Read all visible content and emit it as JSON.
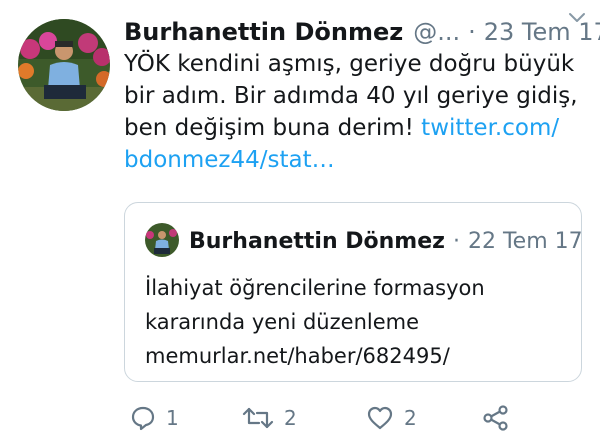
{
  "tweet": {
    "author_name": "Burhanettin Dönmez",
    "handle": "@...",
    "separator": "·",
    "time": "23 Tem 17",
    "text_lines": [
      "YÖK kendini aşmış, geriye doğru büyük",
      "bir adım. Bir adımda 40 yıl geriye gidiş,"
    ],
    "text_line3_prefix": "ben değişim buna derim! ",
    "link_part1": "twitter.com/",
    "link_part2": "bdonmez44/stat…"
  },
  "quoted_tweet": {
    "author_name": "Burhanettin Dönmez",
    "separator": "·",
    "time": "22 Tem 17",
    "text_lines": [
      "İlahiyat öğrencilerine formasyon",
      "kararında yeni düzenleme",
      "memurlar.net/haber/682495/"
    ]
  },
  "actions": {
    "reply_count": "1",
    "retweet_count": "2",
    "like_count": "2"
  },
  "colors": {
    "link": "#1da1f2",
    "muted": "#657786",
    "border": "#ccd6dd"
  },
  "icons": [
    "chevron-down-icon",
    "reply-icon",
    "retweet-icon",
    "heart-icon",
    "share-icon"
  ]
}
